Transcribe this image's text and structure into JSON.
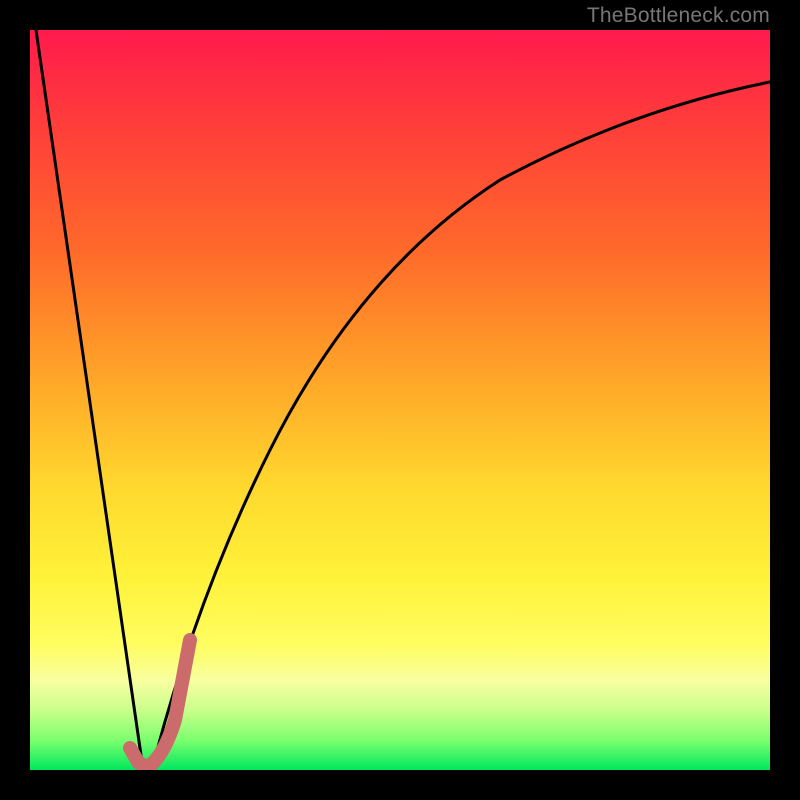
{
  "watermark": "TheBottleneck.com",
  "chart_data": {
    "type": "line",
    "title": "",
    "xlabel": "",
    "ylabel": "",
    "xlim": [
      0,
      100
    ],
    "ylim": [
      0,
      100
    ],
    "grid": false,
    "legend": false,
    "background": "heat-gradient-red-to-green",
    "series": [
      {
        "name": "bottleneck-curve",
        "color": "#000000",
        "x": [
          0,
          5,
          10,
          14,
          15,
          16,
          18,
          22,
          26,
          30,
          36,
          44,
          54,
          66,
          80,
          100
        ],
        "y": [
          100,
          67,
          33,
          5,
          0,
          5,
          16,
          36,
          52,
          63,
          73,
          81,
          87,
          91,
          93,
          95
        ]
      },
      {
        "name": "highlight-segment",
        "color": "#cc6666",
        "x": [
          13,
          14,
          15,
          16,
          17,
          18,
          19
        ],
        "y": [
          2,
          1,
          0,
          1,
          6,
          12,
          19
        ]
      }
    ],
    "annotations": []
  }
}
